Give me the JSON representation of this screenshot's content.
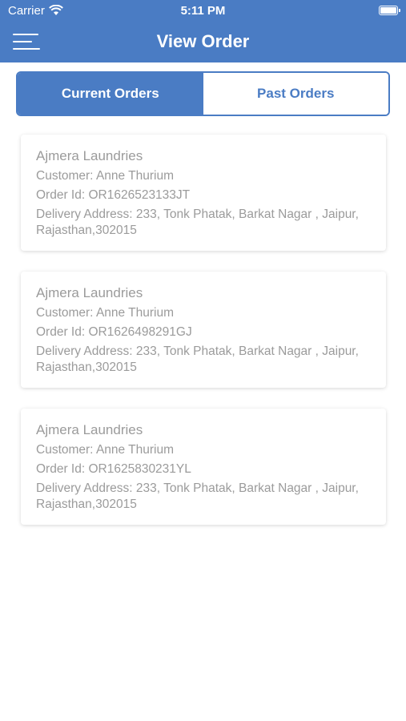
{
  "status_bar": {
    "carrier": "Carrier",
    "time": "5:11 PM"
  },
  "header": {
    "title": "View Order",
    "menu_icon": "hamburger-menu-icon"
  },
  "tabs": [
    {
      "label": "Current Orders",
      "selected": true
    },
    {
      "label": "Past Orders",
      "selected": false
    }
  ],
  "orders": [
    {
      "shop": "Ajmera Laundries",
      "customer": "Customer: Anne Thurium",
      "order_id": "Order Id: OR1626523133JT",
      "address": "Delivery Address: 233, Tonk Phatak, Barkat Nagar , Jaipur, Rajasthan,302015"
    },
    {
      "shop": "Ajmera Laundries",
      "customer": "Customer: Anne Thurium",
      "order_id": "Order Id: OR1626498291GJ",
      "address": "Delivery Address: 233, Tonk Phatak, Barkat Nagar , Jaipur, Rajasthan,302015"
    },
    {
      "shop": "Ajmera Laundries",
      "customer": "Customer: Anne Thurium",
      "order_id": "Order Id: OR1625830231YL",
      "address": "Delivery Address: 233, Tonk Phatak, Barkat Nagar , Jaipur, Rajasthan,302015"
    }
  ],
  "colors": {
    "primary": "#4a7cc4",
    "card_text": "#9b9b9b",
    "background": "#ffffff"
  }
}
